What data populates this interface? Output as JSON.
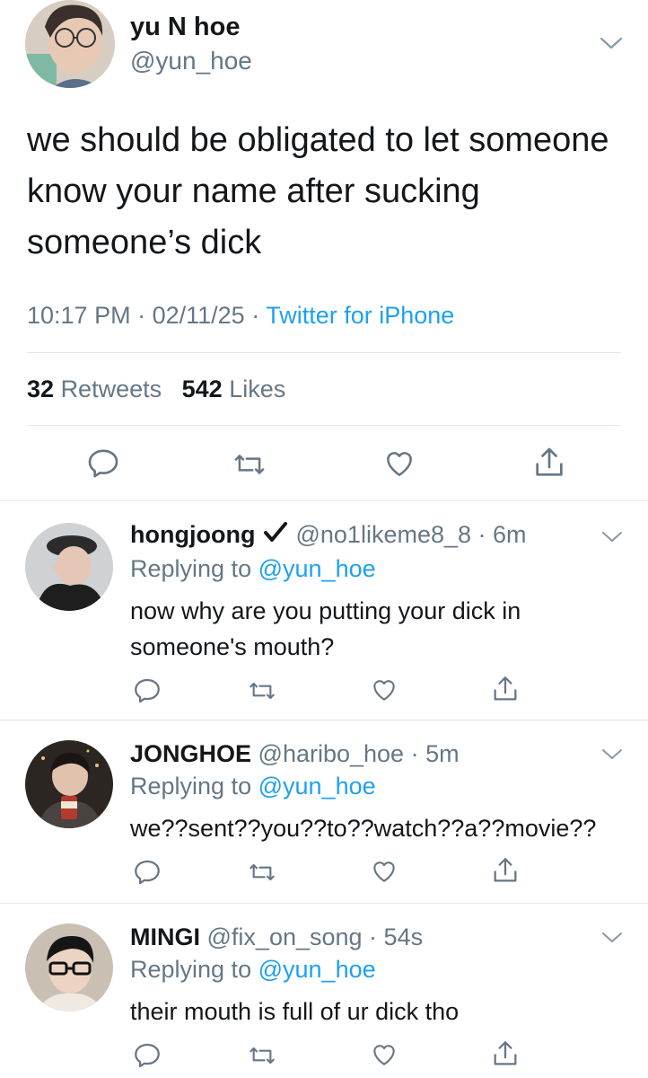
{
  "main": {
    "name": "yu N hoe",
    "handle": "@yun_hoe",
    "text": "we should be obligated to let someone know your name after sucking someone’s dick",
    "time": "10:17 PM",
    "date": "02/11/25",
    "source": "Twitter for iPhone",
    "retweets": "32",
    "retweets_label": "Retweets",
    "likes": "542",
    "likes_label": "Likes"
  },
  "replies": [
    {
      "name": "hongjoong",
      "handle": "@no1likeme8_8",
      "time": "6m",
      "replying_prefix": "Replying to",
      "replying_to": "@yun_hoe",
      "text": "now why are you putting your dick in someone's mouth?"
    },
    {
      "name": "JONGHOE",
      "handle": "@haribo_hoe",
      "time": "5m",
      "replying_prefix": "Replying to",
      "replying_to": "@yun_hoe",
      "text": "we??sent??you??to??watch??a??movie??"
    },
    {
      "name": "MINGI",
      "handle": "@fix_on_song",
      "time": "54s",
      "replying_prefix": "Replying to",
      "replying_to": "@yun_hoe",
      "text": "their mouth is full of ur dick tho"
    }
  ],
  "separator": " · ",
  "icons": [
    "reply-icon",
    "retweet-icon",
    "like-icon",
    "share-icon",
    "chevron-down-icon",
    "verified-check-icon"
  ],
  "colors": {
    "link": "#1da1f2",
    "muted": "#657786",
    "text": "#14171a",
    "divider": "#e1e8ed"
  }
}
